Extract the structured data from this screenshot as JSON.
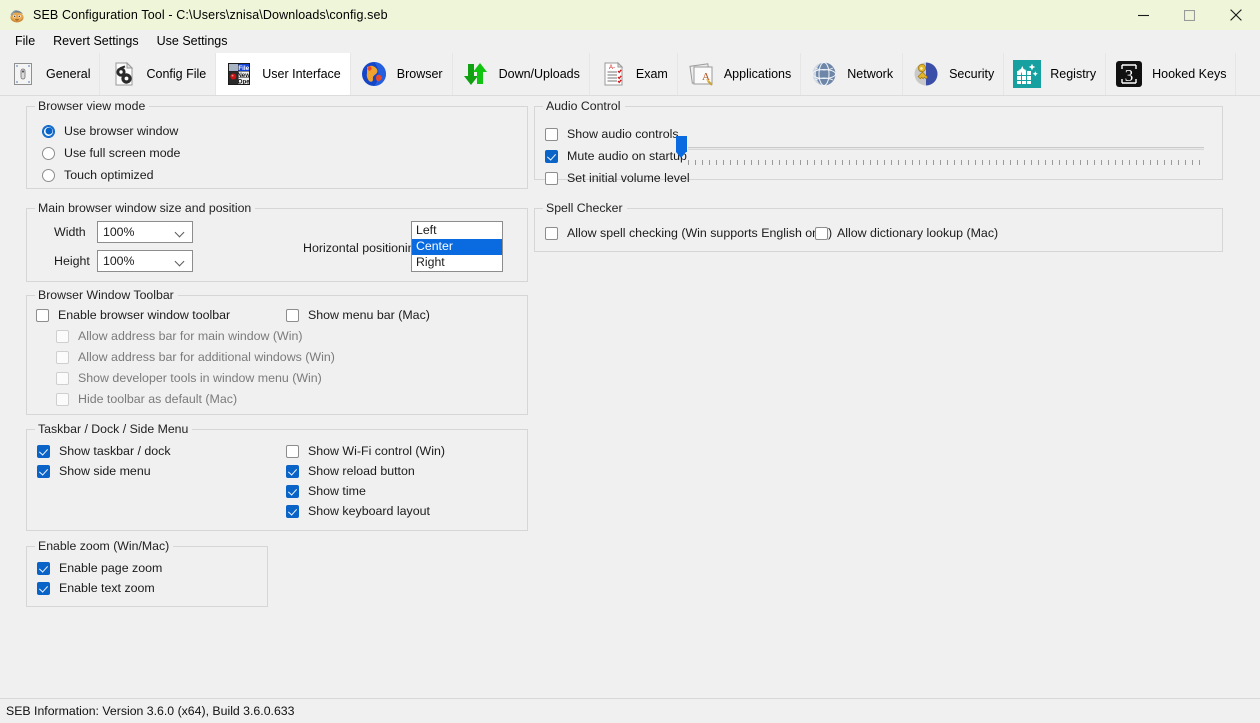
{
  "window": {
    "title": "SEB Configuration Tool - C:\\Users\\znisa\\Downloads\\config.seb",
    "app_icon": "seb-app-icon",
    "minimize": "minimize-icon",
    "maximize": "maximize-icon",
    "close": "close-icon",
    "titlebar_color": "#eef5d8"
  },
  "menubar": {
    "items": [
      {
        "label": "File"
      },
      {
        "label": "Revert Settings"
      },
      {
        "label": "Use Settings"
      }
    ]
  },
  "toolbar": {
    "selected": "User Interface",
    "highlight_color": "#ee1111",
    "items": [
      {
        "label": "General",
        "icon": "general-icon"
      },
      {
        "label": "Config File",
        "icon": "config-file-icon"
      },
      {
        "label": "User Interface",
        "icon": "user-interface-icon"
      },
      {
        "label": "Browser",
        "icon": "browser-globe-icon"
      },
      {
        "label": "Down/Uploads",
        "icon": "down-uploads-arrows-icon"
      },
      {
        "label": "Exam",
        "icon": "exam-checklist-icon"
      },
      {
        "label": "Applications",
        "icon": "applications-icon"
      },
      {
        "label": "Network",
        "icon": "network-globe-icon"
      },
      {
        "label": "Security",
        "icon": "security-key-icon"
      },
      {
        "label": "Registry",
        "icon": "registry-grid-icon"
      },
      {
        "label": "Hooked Keys",
        "icon": "hooked-keys-icon"
      }
    ]
  },
  "browser_view_mode": {
    "title": "Browser view mode",
    "options": [
      {
        "label": "Use browser window",
        "selected": true
      },
      {
        "label": "Use full screen mode",
        "selected": false
      },
      {
        "label": "Touch optimized",
        "selected": false
      }
    ]
  },
  "main_window_size": {
    "title": "Main browser window size and position",
    "width_label": "Width",
    "width_value": "100%",
    "height_label": "Height",
    "height_value": "100%",
    "horizontal_label": "Horizontal positioning",
    "horizontal_options": [
      {
        "label": "Left",
        "selected": false
      },
      {
        "label": "Center",
        "selected": true
      },
      {
        "label": "Right",
        "selected": false
      }
    ]
  },
  "browser_toolbar": {
    "title": "Browser Window Toolbar",
    "enable": {
      "label": "Enable browser window toolbar",
      "checked": false,
      "disabled": false
    },
    "show_menu_bar": {
      "label": "Show menu bar (Mac)",
      "checked": false,
      "disabled": false
    },
    "sub_items": [
      {
        "label": "Allow address bar for main window (Win)",
        "checked": false,
        "disabled": true
      },
      {
        "label": "Allow address bar for additional windows (Win)",
        "checked": false,
        "disabled": true
      },
      {
        "label": "Show developer tools in window menu (Win)",
        "checked": false,
        "disabled": true
      },
      {
        "label": "Hide toolbar as default (Mac)",
        "checked": false,
        "disabled": true
      }
    ]
  },
  "taskbar": {
    "title": "Taskbar / Dock / Side Menu",
    "left_items": [
      {
        "label": "Show taskbar / dock",
        "checked": true
      },
      {
        "label": "Show side menu",
        "checked": true
      }
    ],
    "right_items": [
      {
        "label": "Show Wi-Fi control (Win)",
        "checked": false
      },
      {
        "label": "Show reload button",
        "checked": true
      },
      {
        "label": "Show time",
        "checked": true
      },
      {
        "label": "Show keyboard layout",
        "checked": true
      }
    ]
  },
  "enable_zoom": {
    "title": "Enable zoom (Win/Mac)",
    "items": [
      {
        "label": "Enable page zoom",
        "checked": true
      },
      {
        "label": "Enable text zoom",
        "checked": true
      }
    ]
  },
  "audio_control": {
    "title": "Audio Control",
    "items": [
      {
        "label": "Show audio controls",
        "checked": false
      },
      {
        "label": "Mute audio on startup",
        "checked": true
      },
      {
        "label": "Set initial volume level",
        "checked": false
      }
    ],
    "volume_value": 0
  },
  "spell_checker": {
    "title": "Spell Checker",
    "items": [
      {
        "label": "Allow spell checking (Win supports English only)",
        "checked": false
      },
      {
        "label": "Allow dictionary lookup (Mac)",
        "checked": false
      }
    ]
  },
  "statusbar": {
    "text": "SEB Information: Version 3.6.0 (x64), Build 3.6.0.633"
  }
}
